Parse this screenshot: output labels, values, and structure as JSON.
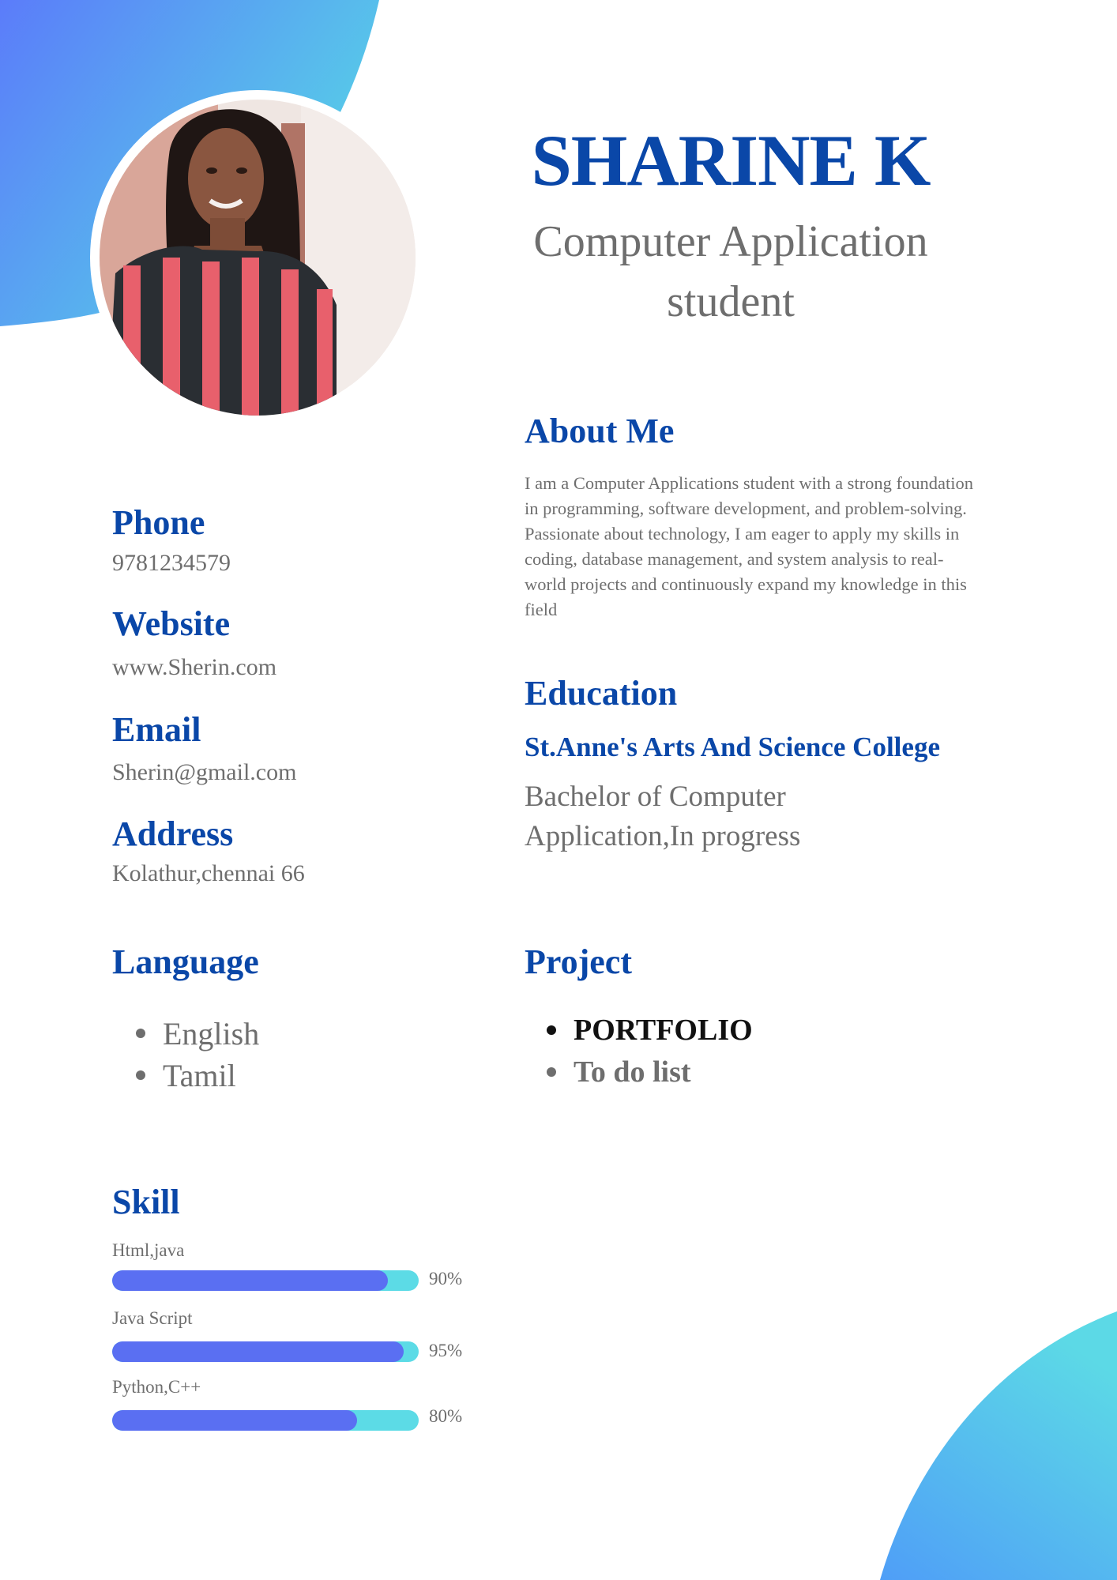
{
  "header": {
    "name": "SHARINE K",
    "role_line1": "Computer Application",
    "role_line2": "student"
  },
  "about": {
    "title": "About Me",
    "text": "I am a Computer Applications student with a strong foundation in programming, software development, and problem-solving. Passionate about technology, I am eager to apply my skills in coding, database management, and system analysis to real-world projects and continuously expand my  knowledge in this field"
  },
  "contact": {
    "phone_label": "Phone",
    "phone": "9781234579",
    "website_label": "Website",
    "website": "www.Sherin.com",
    "email_label": "Email",
    "email": "Sherin@gmail.com",
    "address_label": "Address",
    "address": "Kolathur,chennai 66"
  },
  "education": {
    "title": "Education",
    "college": "St.Anne's Arts And Science College",
    "degree_line1": "Bachelor of Computer",
    "degree_line2": "Application,In progress"
  },
  "language": {
    "title": "Language",
    "items": [
      "English",
      "Tamil"
    ]
  },
  "project": {
    "title": "Project",
    "items": [
      "PORTFOLIO",
      "To do list"
    ]
  },
  "skill": {
    "title": "Skill",
    "items": [
      {
        "label": "Html,java",
        "percent_text": "90%",
        "fill": 0.9
      },
      {
        "label": "Java Script",
        "percent_text": "95%",
        "fill": 0.95
      },
      {
        "label": "Python,C++",
        "percent_text": "80%",
        "fill": 0.8
      }
    ]
  },
  "colors": {
    "heading_blue": "#0a47a8",
    "body_grey": "#6e6e6e",
    "bar_fill": "#5a6ff2",
    "bar_track": "#5cdbe6",
    "gradient_start": "#5b7cfa",
    "gradient_end": "#56d6e6"
  },
  "icons": {
    "bullet": "bullet-dot-icon"
  }
}
